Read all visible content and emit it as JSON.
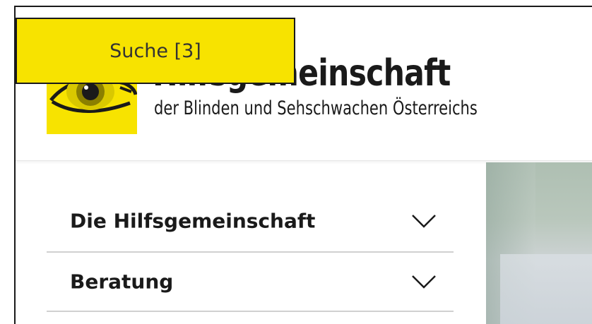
{
  "search": {
    "label": "Suche [3]"
  },
  "logo": {
    "title": "Hilfsgemeinschaft",
    "subtitle": "der Blinden und Sehschwachen Österreichs",
    "icon": "eye-icon",
    "brand_color": "#f7e300"
  },
  "nav": {
    "items": [
      {
        "label": "Die Hilfsgemeinschaft",
        "icon": "chevron-down-icon"
      },
      {
        "label": "Beratung",
        "icon": "chevron-down-icon"
      }
    ]
  },
  "colors": {
    "accent": "#f7e300",
    "text": "#1a1a1a",
    "divider": "#d0d0d0"
  }
}
